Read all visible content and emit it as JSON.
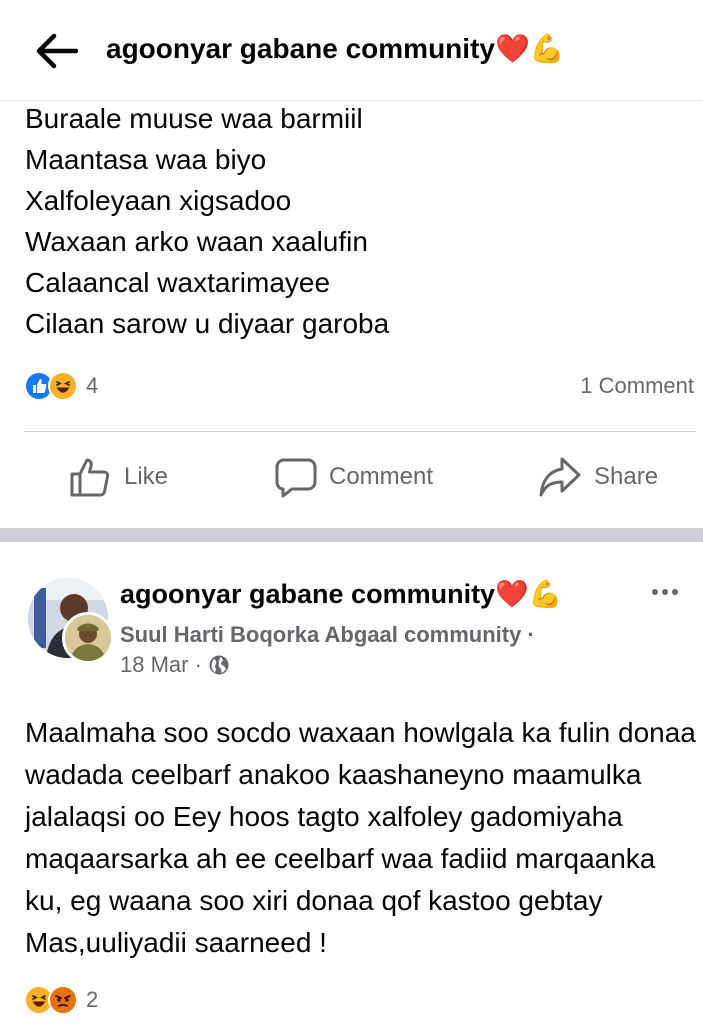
{
  "header": {
    "title": "agoonyar gabane community❤️💪",
    "back_icon": "arrow-left-icon"
  },
  "post1": {
    "lines": [
      "Buraale muuse waa barmiil",
      "Maantasa waa biyo",
      "Xalfoleyaan xigsadoo",
      "Waxaan arko waan xaalufin",
      "Calaancal waxtarimayee",
      "Cilaan sarow u diyaar garoba"
    ],
    "reaction_count": "4",
    "reaction_icons": [
      "like-icon",
      "haha-icon"
    ],
    "comments": "1 Comment"
  },
  "actions": {
    "like": "Like",
    "comment": "Comment",
    "share": "Share"
  },
  "post2": {
    "title": "agoonyar gabane community❤️💪",
    "subtitle": "Suul Harti Boqorka Abgaal community ·",
    "date": "18 Mar ·",
    "body": "Maalmaha soo socdo waxaan howlgala ka fulin donaa wadada ceelbarf anakoo kaashaneyno maamulka jalalaqsi oo Eey hoos tagto xalfoley gadomiyaha maqaarsarka ah ee ceelbarf waa fadiid marqaanka ku, eg  waana soo xiri donaa qof kastoo gebtay Mas,uuliyadii saarneed !",
    "reaction_count": "2",
    "reaction_icons": [
      "haha-icon",
      "angry-icon"
    ]
  },
  "colors": {
    "like_blue": "#1877f2",
    "muted": "#65676b",
    "divider": "#ced0d4",
    "haha_yellow": "#f7b125",
    "angry_orange": "#e9710f"
  }
}
